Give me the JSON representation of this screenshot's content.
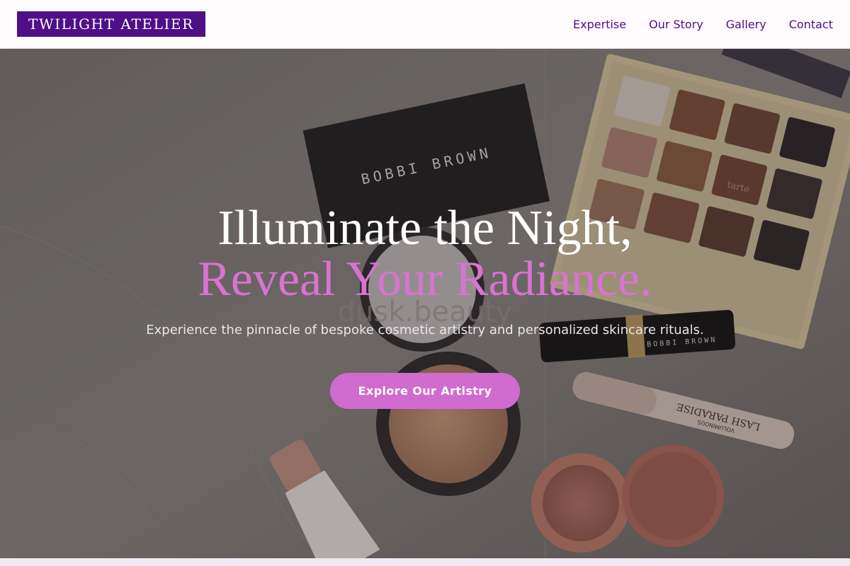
{
  "brand": {
    "name": "TWILIGHT ATELIER",
    "color": "#4f0f86"
  },
  "nav": {
    "items": [
      {
        "label": "Expertise"
      },
      {
        "label": "Our Story"
      },
      {
        "label": "Gallery"
      },
      {
        "label": "Contact"
      }
    ]
  },
  "hero": {
    "headline_line1": "Illuminate the Night,",
    "headline_line2": "Reveal Your Radiance.",
    "subtext": "Experience the pinnacle of bespoke cosmetic artistry and personalized skincare rituals.",
    "cta_label": "Explore Our Artistry",
    "accent_color": "#d873d2",
    "background_image": "flat-lay-makeup-photo",
    "photo_text": {
      "compact_brand": "BOBBI BROWN",
      "lipstick_brand": "BOBBI BROWN",
      "palette_brand": "tarte",
      "mascara_name": "LASH PARADISE",
      "mascara_sub": "VOLUMINOUS",
      "watermark": "dusk.beauty"
    }
  }
}
